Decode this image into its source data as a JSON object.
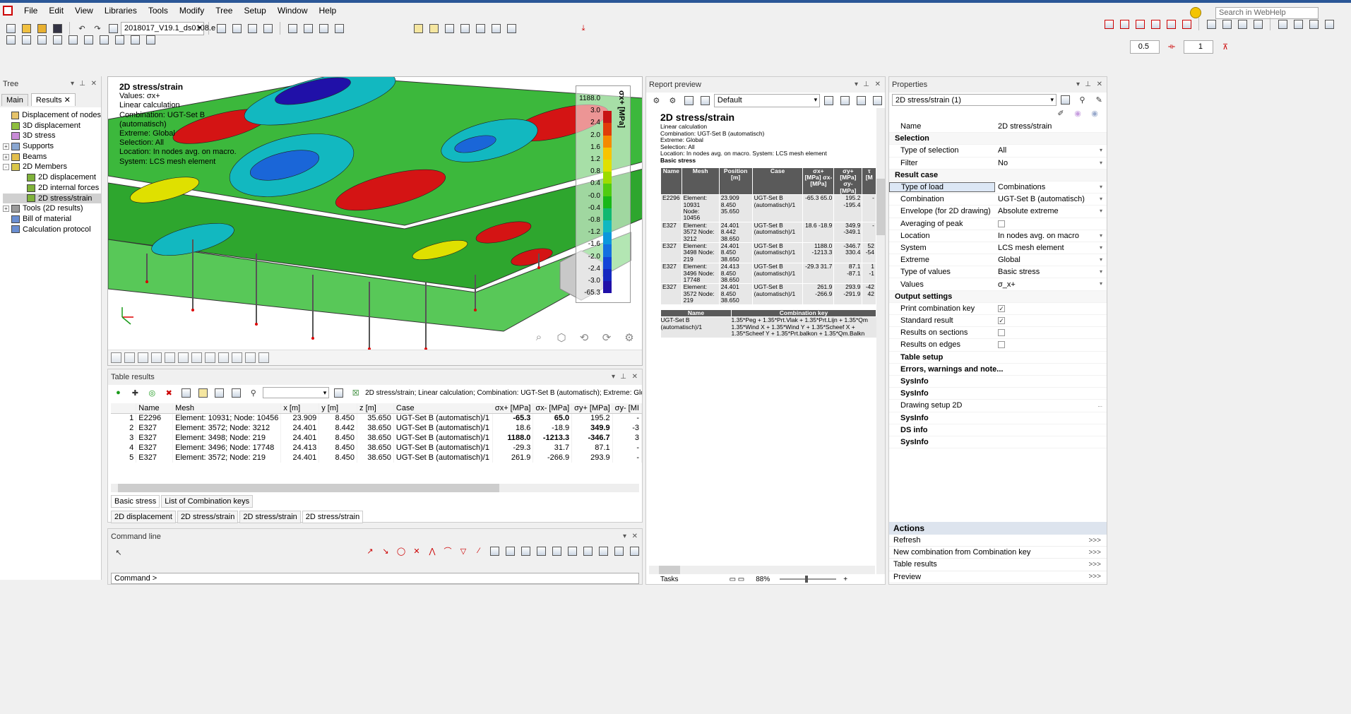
{
  "menu": [
    "File",
    "Edit",
    "View",
    "Libraries",
    "Tools",
    "Modify",
    "Tree",
    "Setup",
    "Window",
    "Help"
  ],
  "search_placeholder": "Search in WebHelp",
  "project_combo": "2018017_V19.1_ds0108.e",
  "spin1": "0.5",
  "spin2": "1",
  "tree": {
    "title": "Tree",
    "tabs": [
      "Main",
      "Results"
    ],
    "items": [
      {
        "label": "Displacement of nodes",
        "level": 0,
        "tog": ""
      },
      {
        "label": "3D displacement",
        "level": 0,
        "tog": ""
      },
      {
        "label": "3D stress",
        "level": 0,
        "tog": ""
      },
      {
        "label": "Supports",
        "level": 0,
        "tog": "+"
      },
      {
        "label": "Beams",
        "level": 0,
        "tog": "+"
      },
      {
        "label": "2D Members",
        "level": 0,
        "tog": "-"
      },
      {
        "label": "2D displacement",
        "level": 1,
        "tog": ""
      },
      {
        "label": "2D internal forces",
        "level": 1,
        "tog": ""
      },
      {
        "label": "2D stress/strain",
        "level": 1,
        "tog": "",
        "selected": true
      },
      {
        "label": "Tools (2D results)",
        "level": 0,
        "tog": "+"
      },
      {
        "label": "Bill of material",
        "level": 0,
        "tog": ""
      },
      {
        "label": "Calculation protocol",
        "level": 0,
        "tog": ""
      }
    ]
  },
  "view": {
    "title": "2D stress/strain",
    "lines": [
      "Values: σx+",
      "Linear calculation",
      "Combination: UGT-Set B",
      "(automatisch)",
      "Extreme: Global",
      "Selection: All",
      "Location: In nodes avg. on macro.",
      "System: LCS mesh element"
    ],
    "legend_unit": "σx+ [MPa]",
    "legend_values": [
      "1188.0",
      "3.0",
      "2.4",
      "2.0",
      "1.6",
      "1.2",
      "0.8",
      "0.4",
      "-0.0",
      "-0.4",
      "-0.8",
      "-1.2",
      "-1.6",
      "-2.0",
      "-2.4",
      "-3.0",
      "-65.3"
    ],
    "legend_colors": [
      "#c81414",
      "#e03c0a",
      "#f58a00",
      "#f7c400",
      "#dfe000",
      "#9ddc00",
      "#50cc10",
      "#18b818",
      "#10b870",
      "#12b8c0",
      "#0c98dc",
      "#1470e0",
      "#1446d8",
      "#1428c0",
      "#2010a8"
    ]
  },
  "table": {
    "title": "Table results",
    "info": "2D stress/strain; Linear calculation; Combination: UGT-Set B (automatisch); Extreme: Global; Selection: All; L",
    "columns": [
      "",
      "Name",
      "Mesh",
      "x [m]",
      "y [m]",
      "z [m]",
      "Case",
      "σx+ [MPa]",
      "σx- [MPa]",
      "σy+ [MPa]",
      "σy- [MI"
    ],
    "rows": [
      [
        "1",
        "E2296",
        "Element: 10931; Node: 10456",
        "23.909",
        "8.450",
        "35.650",
        "UGT-Set B (automatisch)/1",
        "-65.3",
        "65.0",
        "195.2",
        "-"
      ],
      [
        "2",
        "E327",
        "Element: 3572; Node: 3212",
        "24.401",
        "8.442",
        "38.650",
        "UGT-Set B (automatisch)/1",
        "18.6",
        "-18.9",
        "349.9",
        "-3"
      ],
      [
        "3",
        "E327",
        "Element: 3498; Node: 219",
        "24.401",
        "8.450",
        "38.650",
        "UGT-Set B (automatisch)/1",
        "1188.0",
        "-1213.3",
        "-346.7",
        "3"
      ],
      [
        "4",
        "E327",
        "Element: 3496; Node: 17748",
        "24.413",
        "8.450",
        "38.650",
        "UGT-Set B (automatisch)/1",
        "-29.3",
        "31.7",
        "87.1",
        "-"
      ],
      [
        "5",
        "E327",
        "Element: 3572; Node: 219",
        "24.401",
        "8.450",
        "38.650",
        "UGT-Set B (automatisch)/1",
        "261.9",
        "-266.9",
        "293.9",
        "-"
      ]
    ],
    "bottom_tabs": [
      "Basic stress",
      "List of Combination keys"
    ],
    "doc_tabs": [
      "2D displacement",
      "2D stress/strain",
      "2D stress/strain",
      "2D stress/strain"
    ]
  },
  "command": {
    "title": "Command line",
    "prompt": "Command >"
  },
  "report": {
    "title": "Report preview",
    "combo": "Default",
    "heading": "2D stress/strain",
    "lines": [
      "Linear calculation",
      "Combination: UGT-Set B (automatisch)",
      "Extreme: Global",
      "Selection: All",
      "Location: In nodes avg. on macro. System: LCS mesh element"
    ],
    "subheading": "Basic stress",
    "cols": [
      "Name",
      "Mesh",
      "Position [m]",
      "Case",
      "σx+ [MPa] σx- [MPa]",
      "σy+ [MPa] σy- [MPa]",
      "τ [M"
    ],
    "rows": [
      [
        "E2296",
        "Element: 10931 Node: 10456",
        "23.909 8.450 35.650",
        "UGT-Set B (automatisch)/1",
        "-65.3 65.0",
        "195.2 -195.4",
        "-"
      ],
      [
        "E327",
        "Element: 3572 Node: 3212",
        "24.401 8.442 38.650",
        "UGT-Set B (automatisch)/1",
        "18.6 -18.9",
        "349.9 -349.1",
        "-"
      ],
      [
        "E327",
        "Element: 3498 Node: 219",
        "24.401 8.450 38.650",
        "UGT-Set B (automatisch)/1",
        "1188.0 -1213.3",
        "-346.7 330.4",
        "52 -54"
      ],
      [
        "E327",
        "Element: 3496 Node: 17748",
        "24.413 8.450 38.650",
        "UGT-Set B (automatisch)/1",
        "-29.3 31.7",
        "87.1 -87.1",
        "1 -1"
      ],
      [
        "E327",
        "Element: 3572 Node: 219",
        "24.401 8.450 38.650",
        "UGT-Set B (automatisch)/1",
        "261.9 -266.9",
        "293.9 -291.9",
        "-42 42"
      ]
    ],
    "key_cols": [
      "Name",
      "Combination key"
    ],
    "key_name": "UGT-Set B (automatisch)/1",
    "key_value": "1.35*Peg + 1.35*Prt.Vlak + 1.35*Prt.Lijn + 1.35*Qm 1.35*Wind X + 1.35*Wind Y + 1.35*Scheef X + 1.35*Scheef Y + 1.35*Prt.balkon + 1.35*Qm.Balkn",
    "status_tasks": "Tasks",
    "zoom": "88%"
  },
  "props": {
    "title": "Properties",
    "combo": "2D stress/strain (1)",
    "rows": [
      {
        "type": "row",
        "n": "Name",
        "v": "2D stress/strain"
      },
      {
        "type": "sec",
        "n": "Selection"
      },
      {
        "type": "row",
        "n": "Type of selection",
        "v": "All",
        "dd": true
      },
      {
        "type": "row",
        "n": "Filter",
        "v": "No",
        "dd": true
      },
      {
        "type": "sec",
        "n": "Result case"
      },
      {
        "type": "row",
        "n": "Type of load",
        "v": "Combinations",
        "dd": true,
        "sel": true
      },
      {
        "type": "row",
        "n": "Combination",
        "v": "UGT-Set B (automatisch)",
        "dd": true
      },
      {
        "type": "row",
        "n": "Envelope (for 2D drawing)",
        "v": "Absolute extreme",
        "dd": true
      },
      {
        "type": "chk",
        "n": "Averaging of peak",
        "v": ""
      },
      {
        "type": "row",
        "n": "Location",
        "v": "In nodes avg. on macro",
        "dd": true
      },
      {
        "type": "row",
        "n": "System",
        "v": "LCS mesh element",
        "dd": true
      },
      {
        "type": "row",
        "n": "Extreme",
        "v": "Global",
        "dd": true
      },
      {
        "type": "row",
        "n": "Type of values",
        "v": "Basic stress",
        "dd": true
      },
      {
        "type": "row",
        "n": "Values",
        "v": "σ_x+",
        "dd": true
      },
      {
        "type": "sec",
        "n": "Output settings"
      },
      {
        "type": "chk",
        "n": "Print combination key",
        "v": "✓"
      },
      {
        "type": "chk",
        "n": "Standard result",
        "v": "✓"
      },
      {
        "type": "chk",
        "n": "Results on sections",
        "v": ""
      },
      {
        "type": "chk",
        "n": "Results on edges",
        "v": ""
      },
      {
        "type": "exp",
        "n": "Table setup"
      },
      {
        "type": "exp",
        "n": "Errors, warnings and note..."
      },
      {
        "type": "exp",
        "n": "SysInfo"
      },
      {
        "type": "exp",
        "n": "SysInfo"
      },
      {
        "type": "row",
        "n": "Drawing setup 2D",
        "v": "",
        "dots": true
      },
      {
        "type": "exp",
        "n": "SysInfo"
      },
      {
        "type": "exp",
        "n": "DS info"
      },
      {
        "type": "exp",
        "n": "SysInfo"
      }
    ],
    "actions_title": "Actions",
    "actions": [
      "Refresh",
      "New combination from Combination key",
      "Table results",
      "Preview"
    ],
    "action_arrow": ">>>"
  }
}
